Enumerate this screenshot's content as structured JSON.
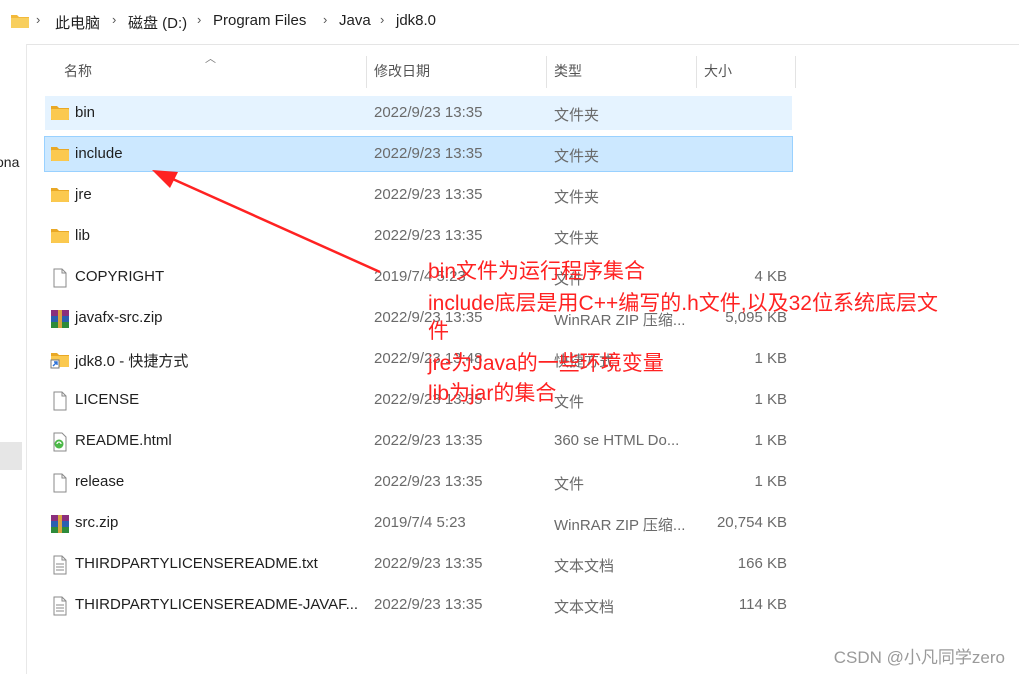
{
  "breadcrumb": {
    "items": [
      "此电脑",
      "磁盘 (D:)",
      "Program Files",
      "Java",
      "jdk8.0"
    ],
    "separator": "›"
  },
  "left_pane": {
    "partial_text": "ona"
  },
  "columns": {
    "name": "名称",
    "modified": "修改日期",
    "type": "类型",
    "size": "大小"
  },
  "files": [
    {
      "name": "bin",
      "date": "2022/9/23 13:35",
      "type": "文件夹",
      "size": "",
      "icon": "folder-icon",
      "state": "hover"
    },
    {
      "name": "include",
      "date": "2022/9/23 13:35",
      "type": "文件夹",
      "size": "",
      "icon": "folder-icon",
      "state": "selected"
    },
    {
      "name": "jre",
      "date": "2022/9/23 13:35",
      "type": "文件夹",
      "size": "",
      "icon": "folder-icon",
      "state": ""
    },
    {
      "name": "lib",
      "date": "2022/9/23 13:35",
      "type": "文件夹",
      "size": "",
      "icon": "folder-icon",
      "state": ""
    },
    {
      "name": "COPYRIGHT",
      "date": "2019/7/4 5:23",
      "type": "文件",
      "size": "4 KB",
      "icon": "file-icon",
      "state": ""
    },
    {
      "name": "javafx-src.zip",
      "date": "2022/9/23 13:35",
      "type": "WinRAR ZIP 压缩...",
      "size": "5,095 KB",
      "icon": "winrar-icon",
      "state": ""
    },
    {
      "name": "jdk8.0 - 快捷方式",
      "date": "2022/9/23 13:48",
      "type": "快捷方式",
      "size": "1 KB",
      "icon": "shortcut-icon",
      "state": ""
    },
    {
      "name": "LICENSE",
      "date": "2022/9/23 13:35",
      "type": "文件",
      "size": "1 KB",
      "icon": "file-icon",
      "state": ""
    },
    {
      "name": "README.html",
      "date": "2022/9/23 13:35",
      "type": "360 se HTML Do...",
      "size": "1 KB",
      "icon": "html-icon",
      "state": ""
    },
    {
      "name": "release",
      "date": "2022/9/23 13:35",
      "type": "文件",
      "size": "1 KB",
      "icon": "file-icon",
      "state": ""
    },
    {
      "name": "src.zip",
      "date": "2019/7/4 5:23",
      "type": "WinRAR ZIP 压缩...",
      "size": "20,754 KB",
      "icon": "winrar-icon",
      "state": ""
    },
    {
      "name": "THIRDPARTYLICENSEREADME.txt",
      "date": "2022/9/23 13:35",
      "type": "文本文档",
      "size": "166 KB",
      "icon": "text-file-icon",
      "state": ""
    },
    {
      "name": "THIRDPARTYLICENSEREADME-JAVAF...",
      "date": "2022/9/23 13:35",
      "type": "文本文档",
      "size": "114 KB",
      "icon": "text-file-icon",
      "state": ""
    }
  ],
  "annotation": {
    "lines": [
      "bin文件为运行程序集合",
      "include底层是用C++编写的.h文件,以及32位系统底层文",
      "件",
      "jre为Java的一些环境变量",
      "lib为jar的集合"
    ],
    "color": "#ff2222"
  },
  "watermark": "CSDN @小凡同学zero",
  "colors": {
    "hover_row": "#e5f3ff",
    "selected_row": "#cce8ff",
    "folder": "#f8c64a",
    "annotation": "#ff2222"
  }
}
